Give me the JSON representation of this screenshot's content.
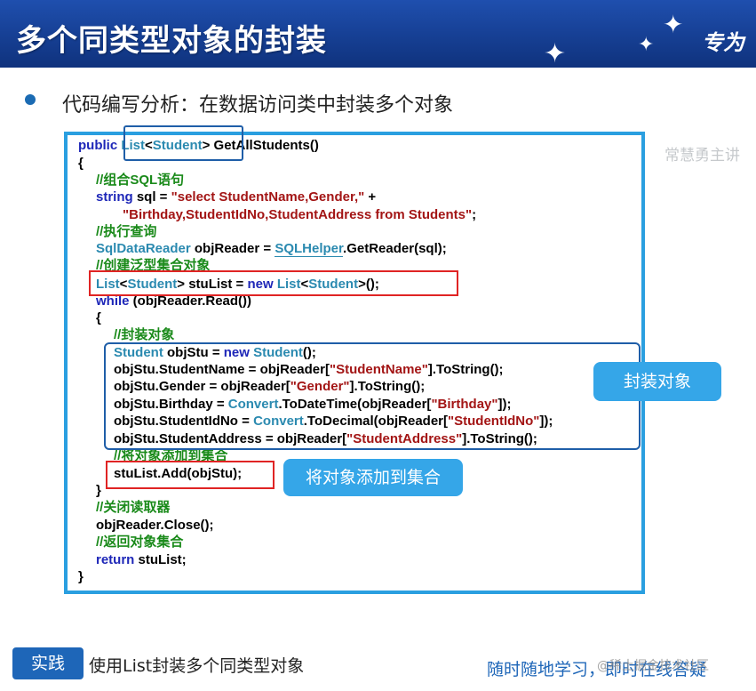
{
  "slide": {
    "title": "多个同类型对象的封装",
    "brand": "专为",
    "heading": "代码编写分析：在数据访问类中封装多个对象",
    "watermark_name": "常慧勇主讲"
  },
  "code": {
    "l1": {
      "a": "public ",
      "b": "List",
      "c": "<",
      "d": "Student",
      "e": "> GetAllStudents()"
    },
    "l2": "{",
    "l3": "//组合SQL语句",
    "l4": {
      "a": "string",
      "b": " sql = ",
      "c": "\"select StudentName,Gender,\"",
      "d": " +"
    },
    "l5": {
      "a": "\"Birthday,StudentIdNo,StudentAddress from Students\"",
      "b": ";"
    },
    "l6": "//执行查询",
    "l7": {
      "a": "SqlDataReader",
      "b": " objReader = ",
      "c": "SQLHelper",
      "d": ".GetReader(sql);"
    },
    "l8": "//创建泛型集合对象",
    "l9": {
      "a": "List",
      "b": "<",
      "c": "Student",
      "d": "> stuList = ",
      "e": "new ",
      "f": "List",
      "g": "<",
      "h": "Student",
      "i": ">();"
    },
    "l10": {
      "a": "while",
      "b": " (objReader.Read())"
    },
    "l11": "{",
    "l12": "//封装对象",
    "l13": {
      "a": "Student",
      "b": " objStu = ",
      "c": "new ",
      "d": "Student",
      "e": "();"
    },
    "l14": {
      "a": "objStu.StudentName = objReader[",
      "b": "\"StudentName\"",
      "c": "].ToString();"
    },
    "l15": {
      "a": "objStu.Gender = objReader[",
      "b": "\"Gender\"",
      "c": "].ToString();"
    },
    "l16": {
      "a": "objStu.Birthday = ",
      "b": "Convert",
      "c": ".ToDateTime(objReader[",
      "d": "\"Birthday\"",
      "e": "]);"
    },
    "l17": {
      "a": "objStu.StudentIdNo = ",
      "b": "Convert",
      "c": ".ToDecimal(objReader[",
      "d": "\"StudentIdNo\"",
      "e": "]);"
    },
    "l18": {
      "a": "objStu.StudentAddress = objReader[",
      "b": "\"StudentAddress\"",
      "c": "].ToString();"
    },
    "l19": "//将对象添加到集合",
    "l20": "stuList.Add(objStu);",
    "l21": "}",
    "l22": "//关闭读取器",
    "l23": "objReader.Close();",
    "l24": "//返回对象集合",
    "l25": {
      "a": "return",
      "b": " stuList;"
    },
    "l26": "}"
  },
  "callouts": {
    "encapsulate": "封装对象",
    "add_to_collection": "将对象添加到集合"
  },
  "footer": {
    "practice_tag": "实践",
    "practice_text": "使用List封装多个同类型对象",
    "slogan": "随时随地学习，即时在线答疑",
    "site_watermark": "@稀土掘金技术社区"
  },
  "colors": {
    "title_bar": "#163f93",
    "code_border": "#2a9fe0",
    "callout_bg": "#35a6e8",
    "highlight_red": "#e02424",
    "highlight_blue": "#1f5ea8"
  },
  "icons": [
    "star-icon",
    "bullet-icon",
    "mouse-cursor-icon"
  ]
}
